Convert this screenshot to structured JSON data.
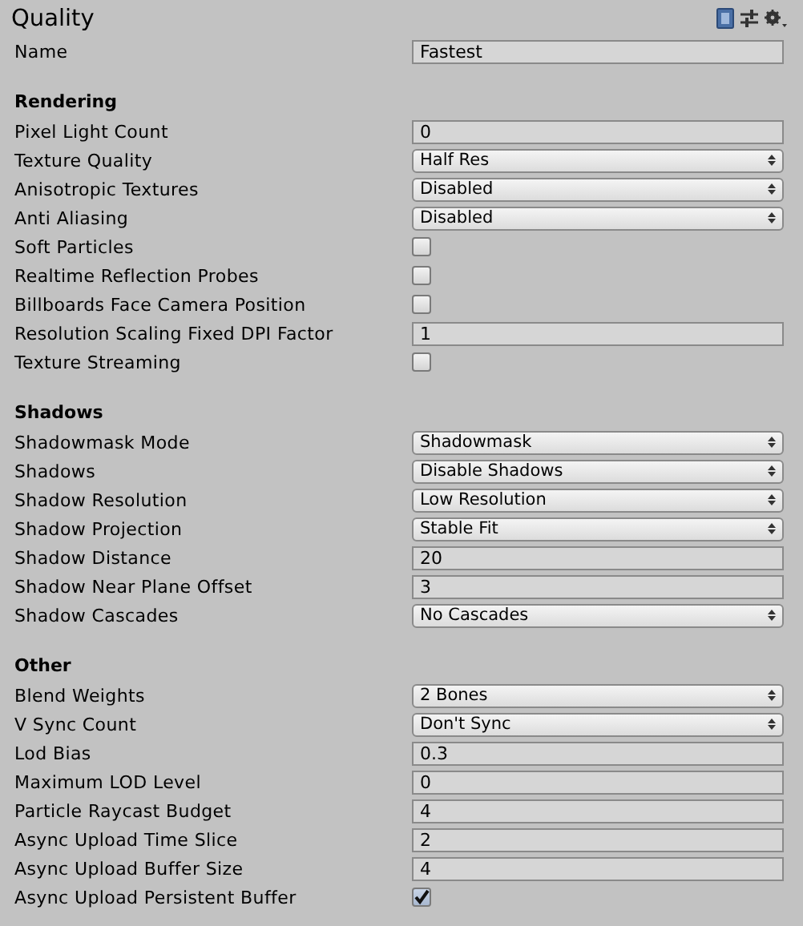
{
  "title": "Quality",
  "name_field": {
    "label": "Name",
    "value": "Fastest"
  },
  "sections": [
    {
      "title": "Rendering",
      "rows": [
        {
          "label": "Pixel Light Count",
          "kind": "text",
          "value": "0"
        },
        {
          "label": "Texture Quality",
          "kind": "dropdown",
          "value": "Half Res"
        },
        {
          "label": "Anisotropic Textures",
          "kind": "dropdown",
          "value": "Disabled"
        },
        {
          "label": "Anti Aliasing",
          "kind": "dropdown",
          "value": "Disabled"
        },
        {
          "label": "Soft Particles",
          "kind": "checkbox",
          "checked": false
        },
        {
          "label": "Realtime Reflection Probes",
          "kind": "checkbox",
          "checked": false
        },
        {
          "label": "Billboards Face Camera Position",
          "kind": "checkbox",
          "checked": false
        },
        {
          "label": "Resolution Scaling Fixed DPI Factor",
          "kind": "text",
          "value": "1"
        },
        {
          "label": "Texture Streaming",
          "kind": "checkbox",
          "checked": false
        }
      ]
    },
    {
      "title": "Shadows",
      "rows": [
        {
          "label": "Shadowmask Mode",
          "kind": "dropdown",
          "value": "Shadowmask"
        },
        {
          "label": "Shadows",
          "kind": "dropdown",
          "value": "Disable Shadows"
        },
        {
          "label": "Shadow Resolution",
          "kind": "dropdown",
          "value": "Low Resolution"
        },
        {
          "label": "Shadow Projection",
          "kind": "dropdown",
          "value": "Stable Fit"
        },
        {
          "label": "Shadow Distance",
          "kind": "text",
          "value": "20"
        },
        {
          "label": "Shadow Near Plane Offset",
          "kind": "text",
          "value": "3"
        },
        {
          "label": "Shadow Cascades",
          "kind": "dropdown",
          "value": "No Cascades"
        }
      ]
    },
    {
      "title": "Other",
      "rows": [
        {
          "label": "Blend Weights",
          "kind": "dropdown",
          "value": "2 Bones"
        },
        {
          "label": "V Sync Count",
          "kind": "dropdown",
          "value": "Don't Sync"
        },
        {
          "label": "Lod Bias",
          "kind": "text",
          "value": "0.3"
        },
        {
          "label": "Maximum LOD Level",
          "kind": "text",
          "value": "0"
        },
        {
          "label": "Particle Raycast Budget",
          "kind": "text",
          "value": "4"
        },
        {
          "label": "Async Upload Time Slice",
          "kind": "text",
          "value": "2"
        },
        {
          "label": "Async Upload Buffer Size",
          "kind": "text",
          "value": "4"
        },
        {
          "label": "Async Upload Persistent Buffer",
          "kind": "checkbox",
          "checked": true
        }
      ]
    }
  ]
}
